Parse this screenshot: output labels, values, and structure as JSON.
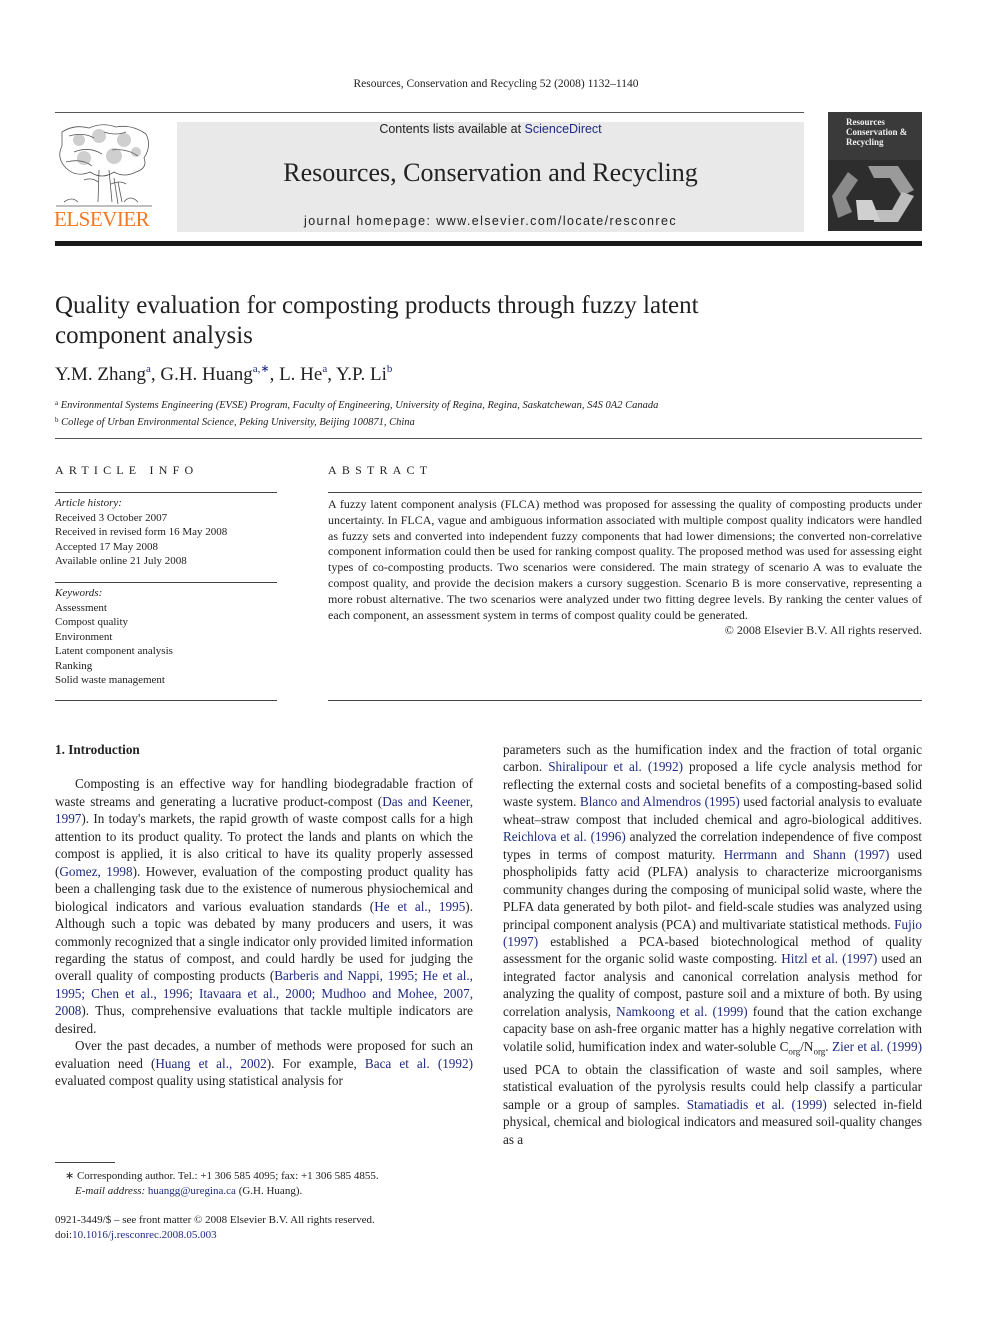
{
  "running_head": "Resources, Conservation and Recycling 52 (2008) 1132–1140",
  "masthead": {
    "publisher_logo_text": "ELSEVIER",
    "contents_prefix": "Contents lists available at ",
    "contents_link": "ScienceDirect",
    "journal_title": "Resources, Conservation and Recycling",
    "homepage_label": "journal homepage: ",
    "homepage_url": "www.elsevier.com/locate/resconrec",
    "cover_title_lines": [
      "Resources",
      "Conservation &",
      "Recycling"
    ],
    "colors": {
      "elsevier_orange": "#f47920",
      "link_blue": "#1f2a80",
      "banner_gray": "#e9e9e9"
    }
  },
  "article": {
    "title": "Quality evaluation for composting products through fuzzy latent component analysis",
    "authors": [
      {
        "name": "Y.M. Zhang",
        "sup": "a"
      },
      {
        "name": "G.H. Huang",
        "sup": "a,∗"
      },
      {
        "name": "L. He",
        "sup": "a"
      },
      {
        "name": "Y.P. Li",
        "sup": "b"
      }
    ],
    "affiliations": [
      {
        "mark": "a",
        "text": "Environmental Systems Engineering (EVSE) Program, Faculty of Engineering, University of Regina, Regina, Saskatchewan, S4S 0A2 Canada"
      },
      {
        "mark": "b",
        "text": "College of Urban Environmental Science, Peking University, Beijing 100871, China"
      }
    ]
  },
  "article_info": {
    "heading": "ARTICLE INFO",
    "history_label": "Article history:",
    "history": [
      "Received 3 October 2007",
      "Received in revised form 16 May 2008",
      "Accepted 17 May 2008",
      "Available online 21 July 2008"
    ],
    "keywords_label": "Keywords:",
    "keywords": [
      "Assessment",
      "Compost quality",
      "Environment",
      "Latent component analysis",
      "Ranking",
      "Solid waste management"
    ]
  },
  "abstract": {
    "heading": "ABSTRACT",
    "text": "A fuzzy latent component analysis (FLCA) method was proposed for assessing the quality of composting products under uncertainty. In FLCA, vague and ambiguous information associated with multiple compost quality indicators were handled as fuzzy sets and converted into independent fuzzy components that had lower dimensions; the converted non-correlative component information could then be used for ranking compost quality. The proposed method was used for assessing eight types of co-composting products. Two scenarios were considered. The main strategy of scenario A was to evaluate the compost quality, and provide the decision makers a cursory suggestion. Scenario B is more conservative, representing a more robust alternative. The two scenarios were analyzed under two fitting degree levels. By ranking the center values of each component, an assessment system in terms of compost quality could be generated.",
    "copyright": "© 2008 Elsevier B.V. All rights reserved."
  },
  "body": {
    "section_heading": "1.  Introduction",
    "left_paragraphs": [
      [
        {
          "t": "Composting is an effective way for handling biodegradable fraction of waste streams and generating a lucrative product-compost ("
        },
        {
          "l": "Das and Keener, 1997"
        },
        {
          "t": "). In today's markets, the rapid growth of waste compost calls for a high attention to its product quality. To protect the lands and plants on which the compost is applied, it is also critical to have its quality properly assessed ("
        },
        {
          "l": "Gomez, 1998"
        },
        {
          "t": "). However, evaluation of the composting product quality has been a challenging task due to the existence of numerous physiochemical and biological indicators and various evaluation standards ("
        },
        {
          "l": "He et al., 1995"
        },
        {
          "t": "). Although such a topic was debated by many producers and users, it was commonly recognized that a single indicator only provided limited information regarding the status of compost, and could hardly be used for judging the overall quality of composting products ("
        },
        {
          "l": "Barberis and Nappi, 1995; He et al., 1995; Chen et al., 1996; Itavaara et al., 2000; Mudhoo and Mohee, 2007, 2008"
        },
        {
          "t": "). Thus, comprehensive evaluations that tackle multiple indicators are desired."
        }
      ],
      [
        {
          "t": "Over the past decades, a number of methods were proposed for such an evaluation need ("
        },
        {
          "l": "Huang et al., 2002"
        },
        {
          "t": "). For example, "
        },
        {
          "l": "Baca et al. (1992)"
        },
        {
          "t": " evaluated compost quality using statistical analysis for"
        }
      ]
    ],
    "right_paragraph": [
      {
        "t": "parameters such as the humification index and the fraction of total organic carbon. "
      },
      {
        "l": "Shiralipour et al. (1992)"
      },
      {
        "t": " proposed a life cycle analysis method for reflecting the external costs and societal benefits of a composting-based solid waste system. "
      },
      {
        "l": "Blanco and Almendros (1995)"
      },
      {
        "t": " used factorial analysis to evaluate wheat–straw compost that included chemical and agro-biological additives. "
      },
      {
        "l": "Reichlova et al. (1996)"
      },
      {
        "t": " analyzed the correlation independence of five compost types in terms of compost maturity. "
      },
      {
        "l": "Herrmann and Shann (1997)"
      },
      {
        "t": " used phospholipids fatty acid (PLFA) analysis to characterize microorganisms community changes during the composing of municipal solid waste, where the PLFA data generated by both pilot- and field-scale studies was analyzed using principal component analysis (PCA) and multivariate statistical methods. "
      },
      {
        "l": "Fujio (1997)"
      },
      {
        "t": " established a PCA-based biotechnological method of quality assessment for the organic solid waste composting. "
      },
      {
        "l": "Hitzl et al. (1997)"
      },
      {
        "t": " used an integrated factor analysis and canonical correlation analysis method for analyzing the quality of compost, pasture soil and a mixture of both. By using correlation analysis, "
      },
      {
        "l": "Namkoong et al. (1999)"
      },
      {
        "t": " found that the cation exchange capacity base on ash-free organic matter has a highly negative correlation with volatile solid, humification index and water-soluble C"
      },
      {
        "s": "org"
      },
      {
        "t": "/N"
      },
      {
        "s": "org"
      },
      {
        "t": ". "
      },
      {
        "l": "Zier et al. (1999)"
      },
      {
        "t": " used PCA to obtain the classification of waste and soil samples, where statistical evaluation of the pyrolysis results could help classify a particular sample or a group of samples. "
      },
      {
        "l": "Stamatiadis et al. (1999)"
      },
      {
        "t": " selected in-field physical, chemical and biological indicators and measured soil-quality changes as a"
      }
    ]
  },
  "footnote": {
    "mark": "∗",
    "text": " Corresponding author. Tel.: +1 306 585 4095; fax: +1 306 585 4855.",
    "email_label": "E-mail address: ",
    "email": "huangg@uregina.ca",
    "email_suffix": " (G.H. Huang)."
  },
  "front_matter": {
    "issn_line": "0921-3449/$ – see front matter © 2008 Elsevier B.V. All rights reserved.",
    "doi_label": "doi:",
    "doi": "10.1016/j.resconrec.2008.05.003"
  }
}
